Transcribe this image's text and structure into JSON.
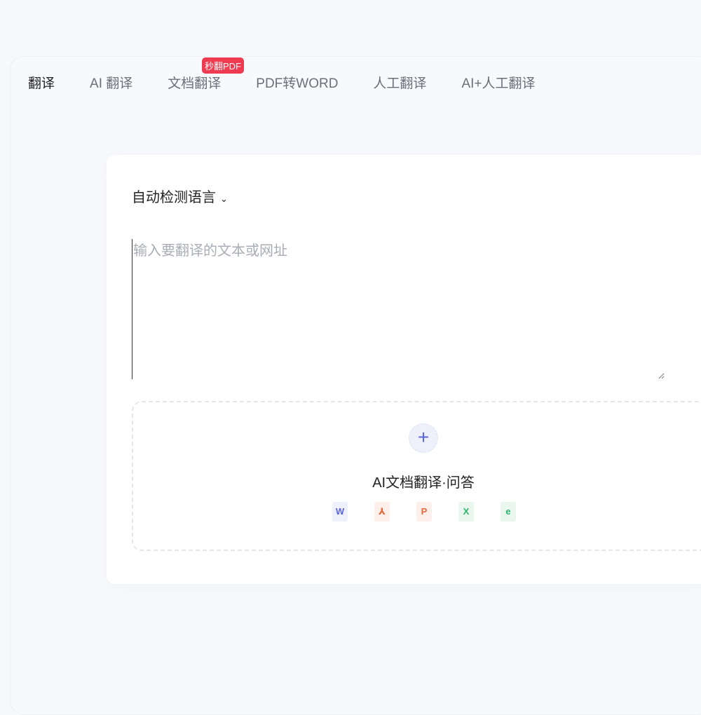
{
  "tabs": [
    "翻译",
    "AI 翻译",
    "文档翻译",
    "PDF转WORD",
    "人工翻译",
    "AI+人工翻译"
  ],
  "badge": "秒翻PDF",
  "source_language": "自动检测语言",
  "input_placeholder": "输入要翻译的文本或网址",
  "upload": {
    "title": "AI文档翻译·问答",
    "plus": "+",
    "file_types": [
      {
        "name": "word",
        "glyph": "W",
        "color": "#5b66d8",
        "bg": "#eef0fb"
      },
      {
        "name": "pdf",
        "glyph": "⅄",
        "color": "#e8663c",
        "bg": "#fdf0ea"
      },
      {
        "name": "ppt",
        "glyph": "P",
        "color": "#e8663c",
        "bg": "#fdf0ea"
      },
      {
        "name": "excel",
        "glyph": "X",
        "color": "#2fb36b",
        "bg": "#e9f7ef"
      },
      {
        "name": "epub",
        "glyph": "e",
        "color": "#2fb36b",
        "bg": "#e9f7ef"
      }
    ]
  }
}
